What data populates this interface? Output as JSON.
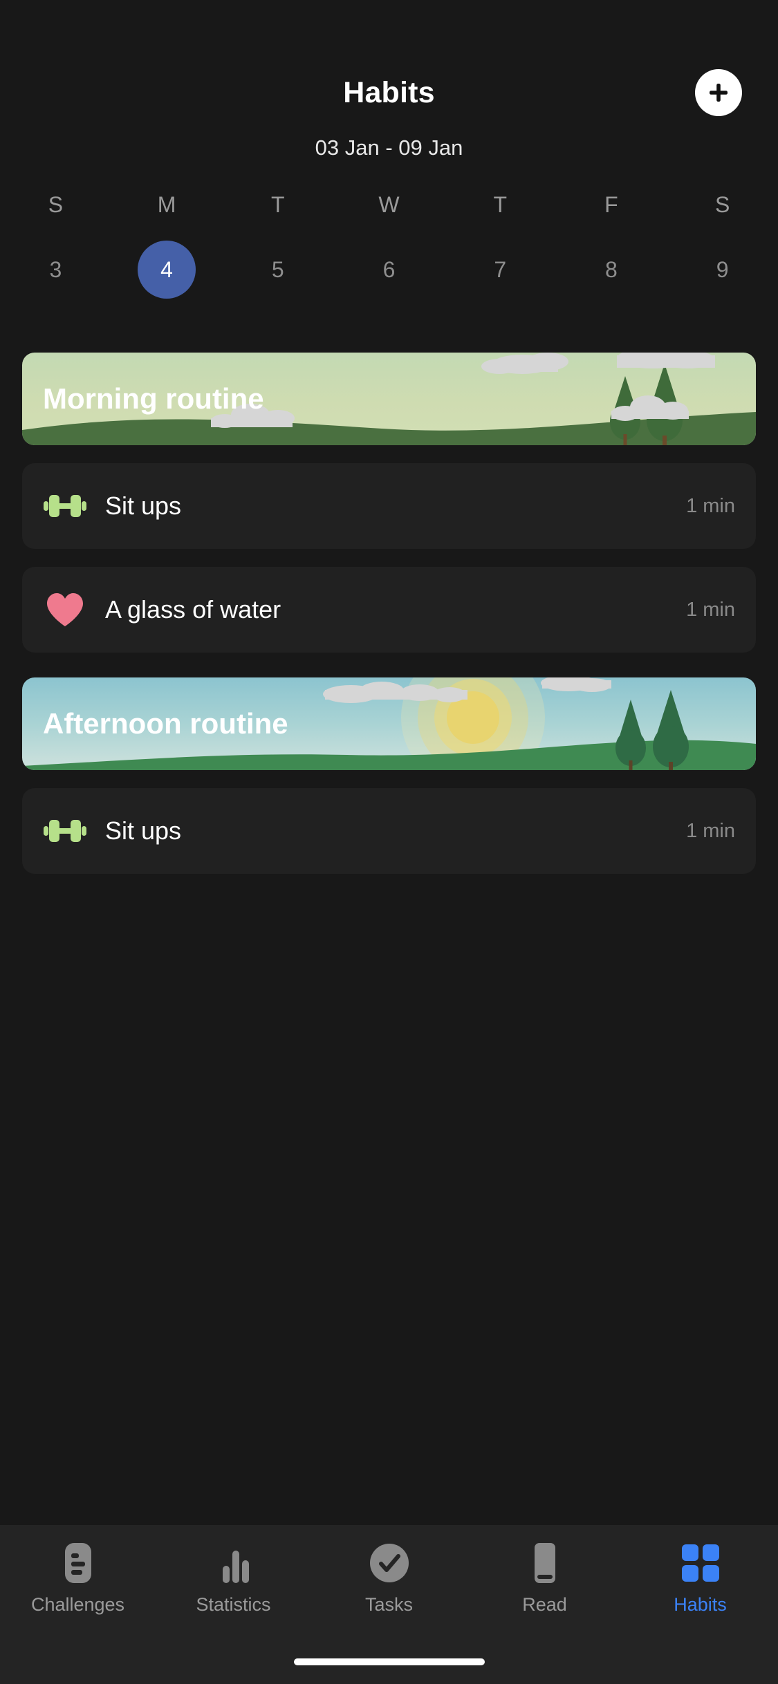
{
  "header": {
    "title": "Habits",
    "add_button_label": "+",
    "add_icon": "plus-icon"
  },
  "date_range": "03 Jan - 09 Jan",
  "week": {
    "day_initials": [
      "S",
      "M",
      "T",
      "W",
      "T",
      "F",
      "S"
    ],
    "day_numbers": [
      "3",
      "4",
      "5",
      "6",
      "7",
      "8",
      "9"
    ],
    "selected_index": 1,
    "selected_day": "4",
    "selected_color": "#4560a8"
  },
  "sections": [
    {
      "banner": {
        "title": "Morning routine",
        "theme": "morning",
        "sky_from": "#c3d9b3",
        "sky_to": "#d2dfb5",
        "hill_color": "#4a7040",
        "tree_color": "#3f6b3a",
        "cloud_color": "#d6d6d6"
      },
      "habits": [
        {
          "icon": "dumbbell-icon",
          "icon_color": "#b6e08a",
          "name": "Sit ups",
          "duration": "1 min"
        },
        {
          "icon": "heart-icon",
          "icon_color": "#ef7a8e",
          "name": "A glass of water",
          "duration": "1 min"
        }
      ]
    },
    {
      "banner": {
        "title": "Afternoon routine",
        "theme": "afternoon",
        "sky_from": "#8cc4cf",
        "sky_to": "#cfe2dd",
        "hill_color": "#3f8a52",
        "tree_color": "#2f6b45",
        "cloud_color": "#d6d6d6",
        "sun_color": "#ecd877"
      },
      "habits": [
        {
          "icon": "dumbbell-icon",
          "icon_color": "#b6e08a",
          "name": "Sit ups",
          "duration": "1 min"
        }
      ]
    }
  ],
  "bottom_nav": {
    "active_index": 4,
    "active_color": "#3b82f6",
    "inactive_color": "#8a8a8a",
    "items": [
      {
        "label": "Challenges",
        "icon": "list-card-icon"
      },
      {
        "label": "Statistics",
        "icon": "bar-chart-icon"
      },
      {
        "label": "Tasks",
        "icon": "check-circle-icon"
      },
      {
        "label": "Read",
        "icon": "book-icon"
      },
      {
        "label": "Habits",
        "icon": "grid-icon"
      }
    ]
  }
}
